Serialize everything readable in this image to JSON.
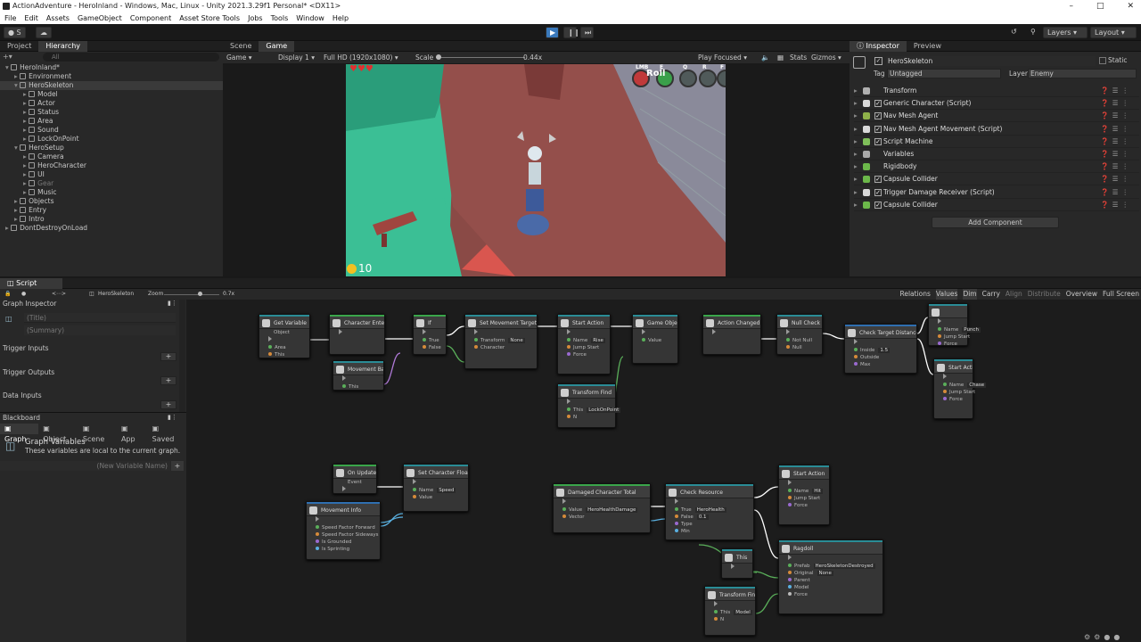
{
  "window": {
    "title": "ActionAdventure - HeroInland - Windows, Mac, Linux - Unity 2021.3.29f1 Personal* <DX11>"
  },
  "menu": [
    "File",
    "Edit",
    "Assets",
    "GameObject",
    "Component",
    "Asset Store Tools",
    "Jobs",
    "Tools",
    "Window",
    "Help"
  ],
  "toolbar": {
    "account": "S",
    "layers": "Layers",
    "layout": "Layout"
  },
  "project_tab": "Project",
  "hierarchy_tab": "Hierarchy",
  "hier_search": "All",
  "hierarchy": [
    {
      "label": "HeroInland*",
      "depth": 0
    },
    {
      "label": "Environment",
      "depth": 1
    },
    {
      "label": "HeroSkeleton",
      "depth": 1
    },
    {
      "label": "Model",
      "depth": 2
    },
    {
      "label": "Actor",
      "depth": 2
    },
    {
      "label": "Status",
      "depth": 2
    },
    {
      "label": "Area",
      "depth": 2
    },
    {
      "label": "Sound",
      "depth": 2
    },
    {
      "label": "LockOnPoint",
      "depth": 2
    },
    {
      "label": "HeroSetup",
      "depth": 1
    },
    {
      "label": "Camera",
      "depth": 2
    },
    {
      "label": "HeroCharacter",
      "depth": 2
    },
    {
      "label": "UI",
      "depth": 2
    },
    {
      "label": "Gear",
      "depth": 2
    },
    {
      "label": "Music",
      "depth": 2
    },
    {
      "label": "Objects",
      "depth": 1
    },
    {
      "label": "Entry",
      "depth": 1
    },
    {
      "label": "Intro",
      "depth": 1
    },
    {
      "label": "DontDestroyOnLoad",
      "depth": 0
    }
  ],
  "scene_tab": "Scene",
  "game_tab": "Game",
  "game_bar": {
    "mode": "Game",
    "display": "Display 1",
    "resolution": "Full HD (1920x1080)",
    "scale_label": "Scale",
    "scale_value": "0.44x",
    "play_focused": "Play Focused",
    "stats": "Stats",
    "gizmos": "Gizmos"
  },
  "hud": {
    "coins": "10",
    "roll": "Roll",
    "keys": [
      "LMB",
      "E",
      "Q",
      "R",
      "F"
    ]
  },
  "inspector": {
    "tab": "Inspector",
    "preview_tab": "Preview",
    "object_name": "HeroSkeleton",
    "static_label": "Static",
    "tag_label": "Tag",
    "tag_value": "Untagged",
    "layer_label": "Layer",
    "layer_value": "Enemy",
    "add_component": "Add Component",
    "components": [
      {
        "label": "Transform",
        "color": "#b0b0b0"
      },
      {
        "label": "Generic Character (Script)",
        "color": "#d9d9d9"
      },
      {
        "label": "Nav Mesh Agent",
        "color": "#8fb24a"
      },
      {
        "label": "Nav Mesh Agent Movement (Script)",
        "color": "#d9d9d9"
      },
      {
        "label": "Script Machine",
        "color": "#7fbf5a"
      },
      {
        "label": "Variables",
        "color": "#aaaaaa"
      },
      {
        "label": "Rigidbody",
        "color": "#6cb84a"
      },
      {
        "label": "Capsule Collider",
        "color": "#6cb84a"
      },
      {
        "label": "Trigger Damage Receiver (Script)",
        "color": "#d9d9d9"
      },
      {
        "label": "Capsule Collider",
        "color": "#6cb84a"
      }
    ]
  },
  "graph": {
    "tab": "Script Graph",
    "breadcrumb": "HeroSkeleton",
    "zoom_label": "Zoom",
    "zoom_value": "0.7x",
    "right_tools": [
      "Relations",
      "Values",
      "Dim",
      "Carry",
      "Align",
      "Distribute",
      "Overview",
      "Full Screen"
    ],
    "inspector_title": "Graph Inspector",
    "title_ph": "(Title)",
    "summary_ph": "(Summary)",
    "trigger_inputs": "Trigger Inputs",
    "trigger_outputs": "Trigger Outputs",
    "data_inputs": "Data Inputs",
    "blackboard": "Blackboard",
    "bb_tabs": [
      "Graph",
      "Object",
      "Scene",
      "App",
      "Saved"
    ],
    "gv_title": "Graph Variables",
    "gv_desc": "These variables are local to the current graph.",
    "new_var_ph": "(New Variable Name)"
  },
  "nodes": [
    {
      "id": "get-variable",
      "title": "Get Variable",
      "sub": "Object",
      "rows": [
        "Area",
        "This"
      ]
    },
    {
      "id": "character-enter",
      "title": "Character Enter",
      "rows": []
    },
    {
      "id": "if",
      "title": "If",
      "rows": [
        "True",
        "False"
      ]
    },
    {
      "id": "set-movement-target",
      "title": "Set Movement Target",
      "rows": [
        "Transform",
        "Character"
      ],
      "vals": [
        "None"
      ]
    },
    {
      "id": "start-action-1",
      "title": "Start Action",
      "rows": [
        "Name",
        "Jump Start",
        "Force"
      ],
      "vals": [
        "Rise"
      ]
    },
    {
      "id": "set-active",
      "title": "Game Object Set Active",
      "rows": [
        "Value"
      ]
    },
    {
      "id": "action-changed",
      "title": "Action Changed",
      "rows": []
    },
    {
      "id": "null-check",
      "title": "Null Check",
      "rows": [
        "Not Null",
        "Null"
      ]
    },
    {
      "id": "check-target-distance",
      "title": "Check Target Distance",
      "rows": [
        "Inside",
        "Outside",
        "Max"
      ],
      "vals": [
        "1.5"
      ]
    },
    {
      "id": "start-action-punch",
      "title": "",
      "rows": [
        "Name",
        "Jump Start",
        "Force"
      ],
      "vals": [
        "Punch"
      ]
    },
    {
      "id": "start-action-chase",
      "title": "Start Action",
      "rows": [
        "Name",
        "Jump Start",
        "Force"
      ],
      "vals": [
        "Chase"
      ]
    },
    {
      "id": "has-target",
      "title": "Movement Base Has Target",
      "rows": [
        "This"
      ]
    },
    {
      "id": "transform-find-1",
      "title": "Transform Find",
      "rows": [
        "This",
        "N"
      ],
      "vals": [
        "LockOnPoint"
      ]
    },
    {
      "id": "on-update",
      "title": "On Update",
      "sub": "Event",
      "rows": []
    },
    {
      "id": "set-character-float",
      "title": "Set Character Float",
      "rows": [
        "Name",
        "Value"
      ],
      "vals": [
        "Speed"
      ]
    },
    {
      "id": "movement-info",
      "title": "Movement Info",
      "rows": [
        "Speed Factor Forward",
        "Speed Factor Sideways",
        "Is Grounded",
        "Is Sprinting"
      ]
    },
    {
      "id": "damaged-character-total",
      "title": "Damaged Character Total",
      "rows": [
        "Value",
        "Vector"
      ],
      "vals": [
        "HeroHealthDamage"
      ]
    },
    {
      "id": "check-resource",
      "title": "Check Resource",
      "rows": [
        "True",
        "False",
        "Type",
        "Min"
      ],
      "vals": [
        "HeroHealth",
        "0.1"
      ]
    },
    {
      "id": "start-action-hit",
      "title": "Start Action",
      "rows": [
        "Name",
        "Jump Start",
        "Force"
      ],
      "vals": [
        "Hit"
      ]
    },
    {
      "id": "this",
      "title": "This",
      "rows": []
    },
    {
      "id": "ragdoll",
      "title": "Ragdoll",
      "rows": [
        "Prefab",
        "Original",
        "Parent",
        "Model",
        "Force"
      ],
      "vals": [
        "HeroSkeletonDestroyed",
        "None"
      ]
    },
    {
      "id": "transform-find-2",
      "title": "Transform Find",
      "rows": [
        "This",
        "N"
      ],
      "vals": [
        "Model"
      ]
    }
  ]
}
